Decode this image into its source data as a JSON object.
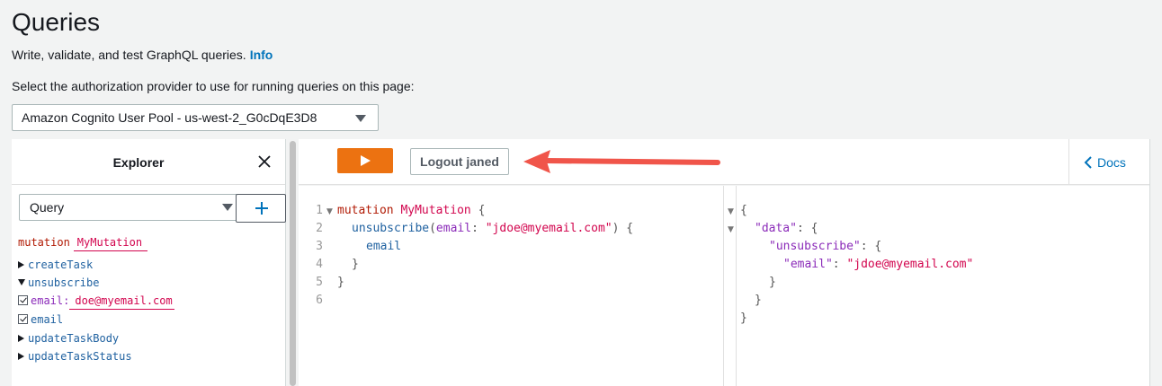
{
  "header": {
    "title": "Queries",
    "subtitle": "Write, validate, and test GraphQL queries.",
    "info_link": "Info",
    "auth_label": "Select the authorization provider to use for running queries on this page:",
    "auth_selected": "Amazon Cognito User Pool - us-west-2_G0cDqE3D8"
  },
  "explorer": {
    "title": "Explorer",
    "operation_type": "Query",
    "operation_keyword": "mutation",
    "operation_name": "MyMutation",
    "fields": {
      "create_task": "createTask",
      "unsubscribe": "unsubscribe",
      "email_arg_name": "email:",
      "email_arg_value": "doe@myemail.com",
      "email_field": "email",
      "update_task_body": "updateTaskBody",
      "update_task_status": "updateTaskStatus"
    }
  },
  "toolbar": {
    "logout_label": "Logout janed",
    "docs_label": "Docs"
  },
  "editor": {
    "line_numbers": [
      "1",
      "2",
      "3",
      "4",
      "5",
      "6"
    ],
    "kw_mutation": "mutation",
    "op_name": "MyMutation",
    "open_brace": "{",
    "unsubscribe": "unsubscribe",
    "open_paren": "(",
    "arg": "email",
    "colon": ":",
    "arg_value": "\"jdoe@myemail.com\"",
    "close_paren_brace": ") {",
    "field_email": "email",
    "close_brace": "}"
  },
  "result": {
    "open": "{",
    "data_key": "\"data\"",
    "unsubscribe_key": "\"unsubscribe\"",
    "email_key": "\"email\"",
    "email_value": "\"jdoe@myemail.com\"",
    "colon_brace": ": {",
    "colon": ": ",
    "close": "}"
  },
  "colors": {
    "run_button": "#ec7211",
    "link": "#0073bb",
    "annotation_arrow": "#f0554a"
  }
}
